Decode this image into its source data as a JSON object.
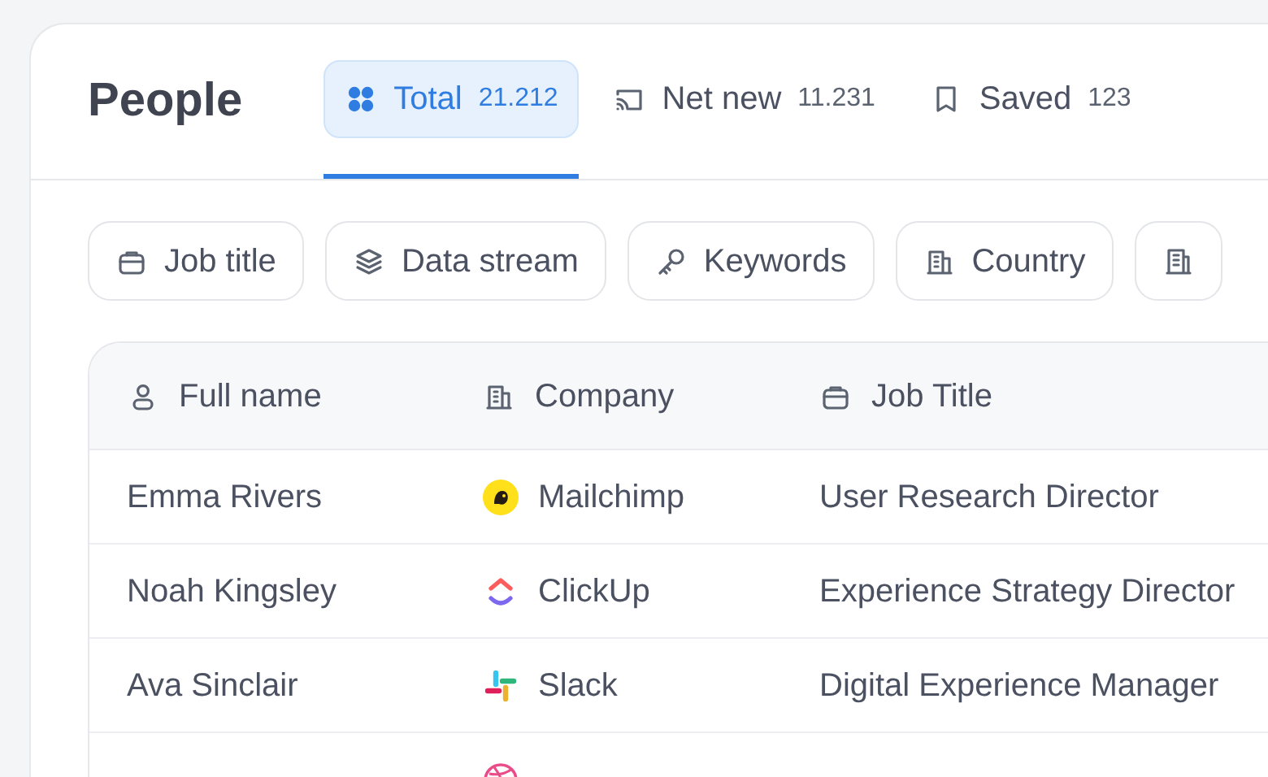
{
  "page": {
    "title": "People"
  },
  "tabs": [
    {
      "label": "Total",
      "count": "21.212",
      "selected": true
    },
    {
      "label": "Net new",
      "count": "11.231",
      "selected": false
    },
    {
      "label": "Saved",
      "count": "123",
      "selected": false
    }
  ],
  "filters": [
    {
      "label": "Job title"
    },
    {
      "label": "Data stream"
    },
    {
      "label": "Keywords"
    },
    {
      "label": "Country"
    }
  ],
  "table": {
    "columns": [
      {
        "label": "Full name"
      },
      {
        "label": "Company"
      },
      {
        "label": "Job Title"
      }
    ],
    "rows": [
      {
        "name": "Emma Rivers",
        "company": "Mailchimp",
        "job_title": "User Research Director"
      },
      {
        "name": "Noah Kingsley",
        "company": "ClickUp",
        "job_title": "Experience Strategy Director"
      },
      {
        "name": "Ava Sinclair",
        "company": "Slack",
        "job_title": "Digital Experience Manager"
      }
    ]
  }
}
